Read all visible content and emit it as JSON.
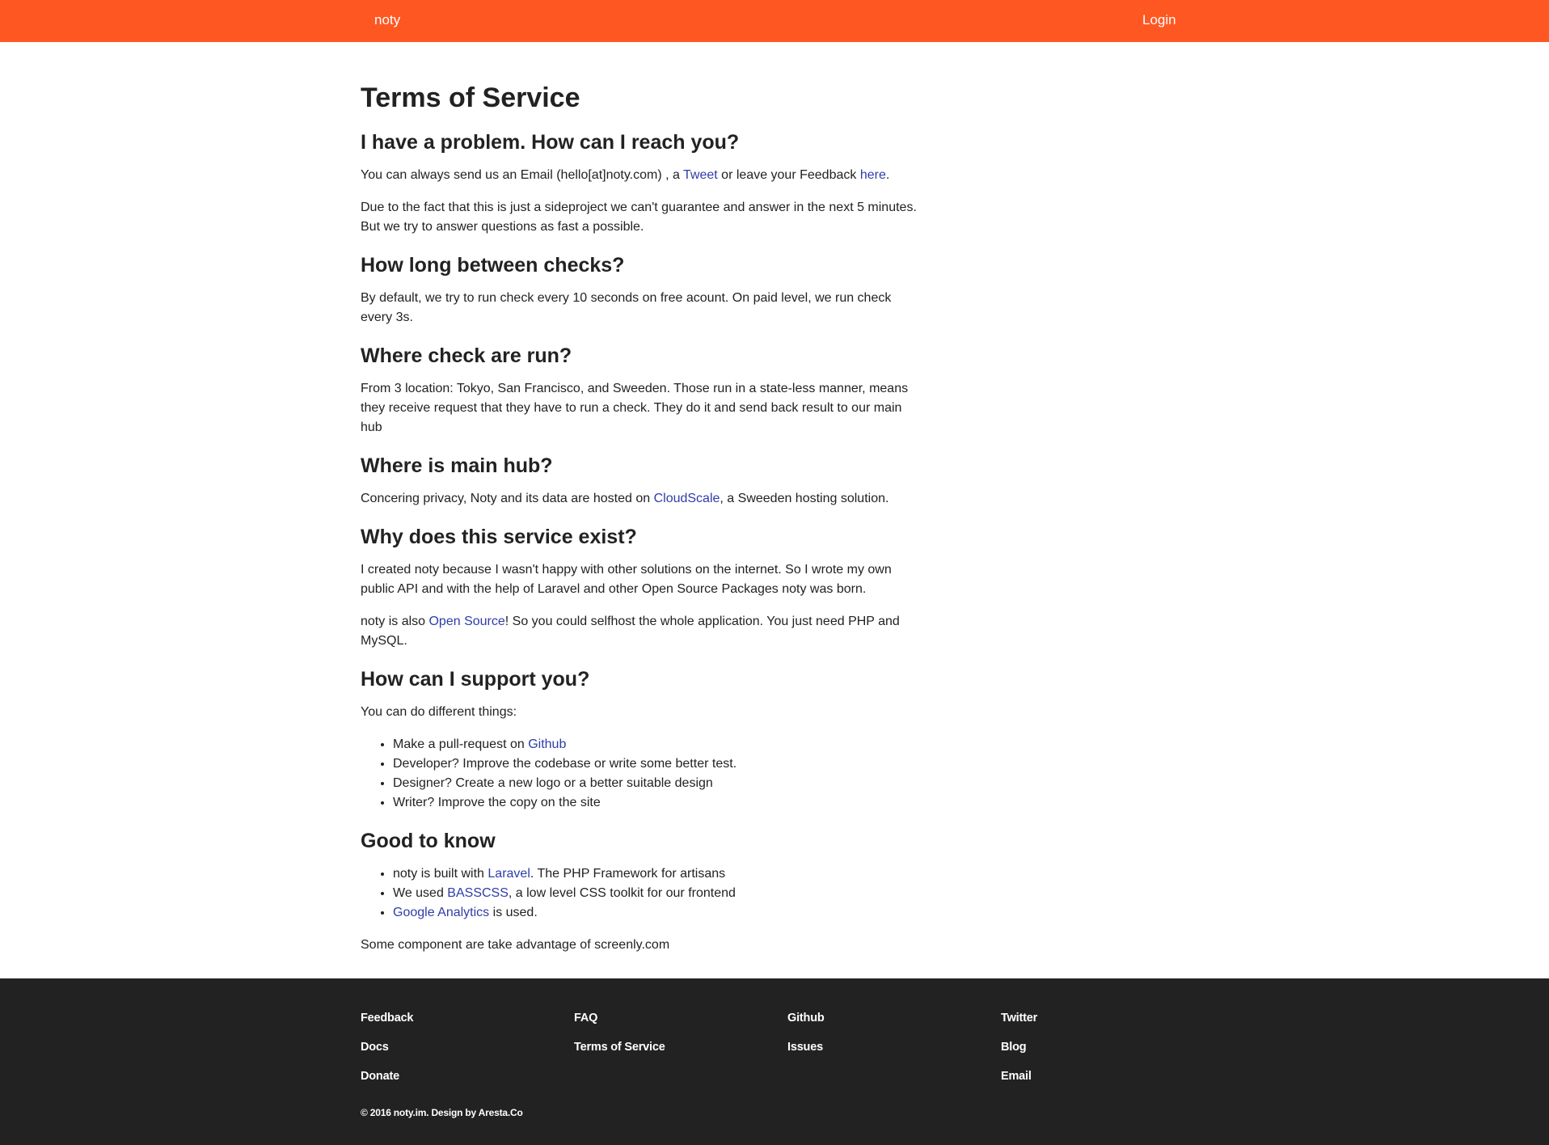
{
  "nav": {
    "brand": "noty",
    "login": "Login"
  },
  "page": {
    "title": "Terms of Service",
    "sections": {
      "contact": {
        "heading": "I have a problem. How can I reach you?",
        "p1_pre": "You can always send us an Email (hello[at]noty.com) , a ",
        "p1_link1": "Tweet",
        "p1_mid": " or leave your Feedback ",
        "p1_link2": "here",
        "p1_post": ".",
        "p2": "Due to the fact that this is just a sideproject we can't guarantee and answer in the next 5 minutes. But we try to answer questions as fast a possible."
      },
      "checks": {
        "heading": "How long between checks?",
        "p1": "By default, we try to run check every 10 seconds on free acount. On paid level, we run check every 3s."
      },
      "where_run": {
        "heading": "Where check are run?",
        "p1": "From 3 location: Tokyo, San Francisco, and Sweeden. Those run in a state-less manner, means they receive request that they have to run a check. They do it and send back result to our main hub"
      },
      "main_hub": {
        "heading": "Where is main hub?",
        "p1_pre": "Concering privacy, Noty and its data are hosted on ",
        "p1_link": "CloudScale",
        "p1_post": ", a Sweeden hosting solution."
      },
      "why": {
        "heading": "Why does this service exist?",
        "p1": "I created noty because I wasn't happy with other solutions on the internet. So I wrote my own public API and with the help of Laravel and other Open Source Packages noty was born.",
        "p2_pre": "noty is also ",
        "p2_link": "Open Source",
        "p2_post": "! So you could selfhost the whole application. You just need PHP and MySQL."
      },
      "support": {
        "heading": "How can I support you?",
        "intro": "You can do different things:",
        "item1_pre": "Make a pull-request on ",
        "item1_link": "Github",
        "item2": "Developer? Improve the codebase or write some better test.",
        "item3": "Designer? Create a new logo or a better suitable design",
        "item4": "Writer? Improve the copy on the site"
      },
      "good": {
        "heading": "Good to know",
        "item1_pre": "noty is built with ",
        "item1_link": "Laravel",
        "item1_post": ". The PHP Framework for artisans",
        "item2_pre": "We used ",
        "item2_link": "BASSCSS",
        "item2_post": ", a low level CSS toolkit for our frontend",
        "item3_link": "Google Analytics",
        "item3_post": " is used.",
        "closing": "Some component are take advantage of screenly.com"
      }
    }
  },
  "footer": {
    "col1": [
      "Feedback",
      "Docs",
      "Donate"
    ],
    "col2": [
      "FAQ",
      "Terms of Service"
    ],
    "col3": [
      "Github",
      "Issues"
    ],
    "col4": [
      "Twitter",
      "Blog",
      "Email"
    ],
    "copyright": "© 2016 noty.im. Design by Aresta.Co"
  },
  "colors": {
    "header": "#ff5722",
    "footer": "#222222",
    "link": "#2e3da8",
    "text": "#222222"
  }
}
